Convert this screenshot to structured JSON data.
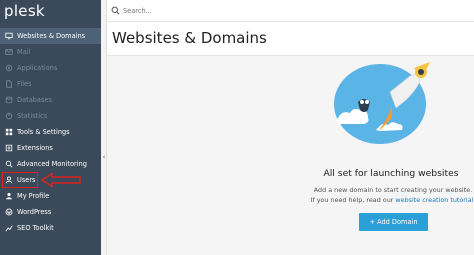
{
  "app": {
    "logo": "plesk"
  },
  "search": {
    "placeholder": "Search..."
  },
  "sidebar": {
    "items": [
      {
        "label": "Websites & Domains",
        "icon": "monitor-icon",
        "state": "active"
      },
      {
        "label": "Mail",
        "icon": "mail-icon",
        "state": "disabled"
      },
      {
        "label": "Applications",
        "icon": "applications-icon",
        "state": "disabled"
      },
      {
        "label": "Files",
        "icon": "files-icon",
        "state": "disabled"
      },
      {
        "label": "Databases",
        "icon": "databases-icon",
        "state": "disabled"
      },
      {
        "label": "Statistics",
        "icon": "statistics-icon",
        "state": "disabled"
      },
      {
        "label": "Tools & Settings",
        "icon": "tools-icon",
        "state": "normal"
      },
      {
        "label": "Extensions",
        "icon": "extensions-icon",
        "state": "normal"
      },
      {
        "label": "Advanced Monitoring",
        "icon": "monitoring-icon",
        "state": "normal"
      },
      {
        "label": "Users",
        "icon": "user-icon",
        "state": "highlighted"
      },
      {
        "label": "My Profile",
        "icon": "profile-icon",
        "state": "normal"
      },
      {
        "label": "WordPress",
        "icon": "wordpress-icon",
        "state": "normal"
      },
      {
        "label": "SEO Toolkit",
        "icon": "seo-icon",
        "state": "normal"
      }
    ]
  },
  "main": {
    "title": "Websites & Domains",
    "empty_state": {
      "heading": "All set for launching websites",
      "line1": "Add a new domain to start creating your website.",
      "line2_prefix": "If you need help, read our ",
      "line2_link": "website creation tutorial",
      "line2_suffix": ".",
      "button_label": "+ Add Domain"
    }
  },
  "colors": {
    "sidebar_bg": "#3b4a5a",
    "active_item_bg": "#4d6276",
    "accent": "#2aa0d8",
    "highlight": "#e02020"
  }
}
